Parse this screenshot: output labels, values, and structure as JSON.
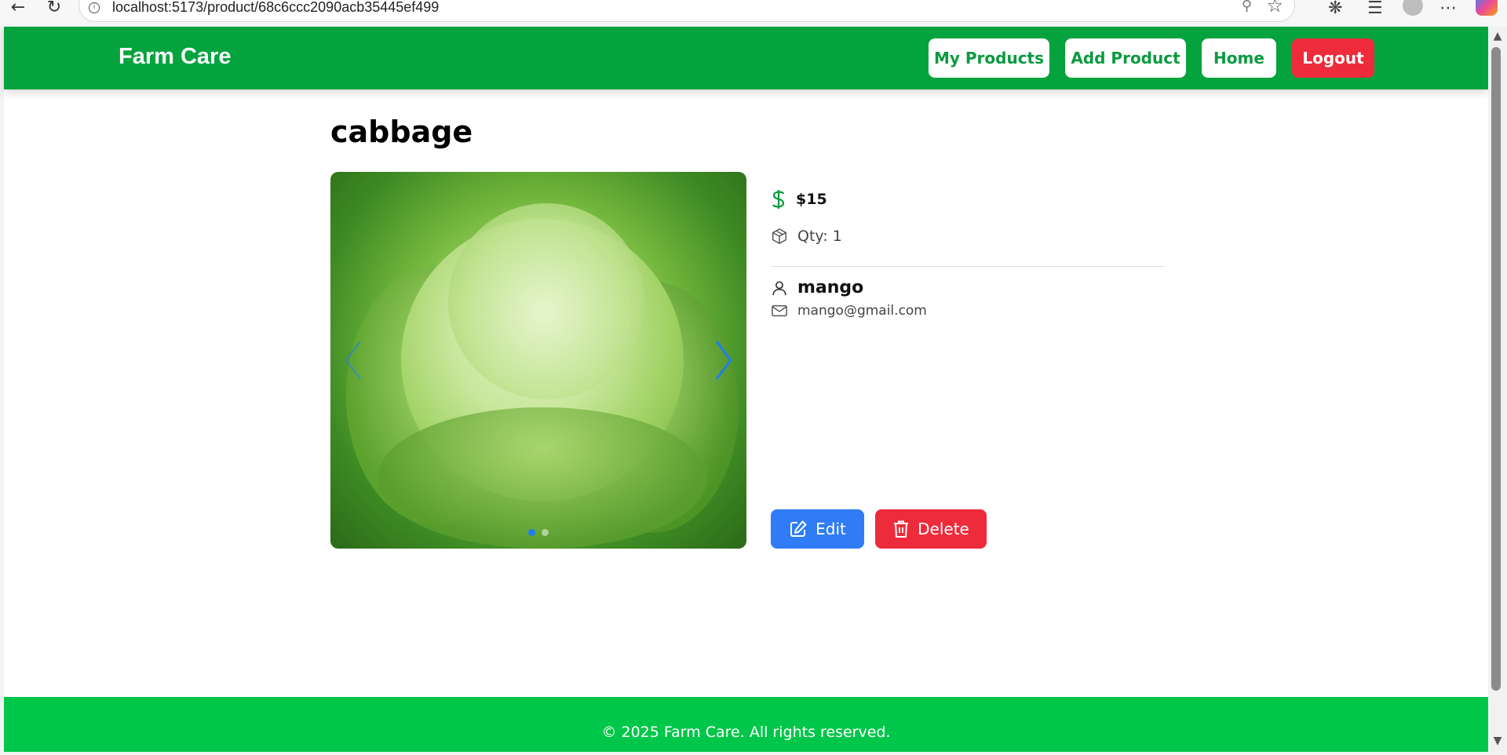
{
  "browser": {
    "url": "localhost:5173/product/68c6ccc2090acb35445ef499"
  },
  "header": {
    "brand": "Farm Care",
    "nav": {
      "my_products": "My Products",
      "add_product": "Add Product",
      "home": "Home",
      "logout": "Logout"
    },
    "colors": {
      "header_bg": "#04a33e",
      "logout_bg": "#ee2b3b"
    }
  },
  "product": {
    "name": "cabbage",
    "price": "$15",
    "qty": "Qty: 1",
    "image_alt": "cabbage",
    "carousel": {
      "total_slides": 2,
      "active_slide": 1
    }
  },
  "seller": {
    "name": "mango",
    "email": "mango@gmail.com"
  },
  "actions": {
    "edit": "Edit",
    "delete": "Delete"
  },
  "footer": {
    "text": "© 2025 Farm Care. All rights reserved."
  },
  "icons": [
    "back-icon",
    "reload-icon",
    "info-icon",
    "key-icon",
    "star-icon",
    "extensions-icon",
    "favorites-icon",
    "profile-icon",
    "more-icon",
    "copilot-icon",
    "dollar-icon",
    "box-icon",
    "user-icon",
    "mail-icon",
    "edit-icon",
    "trash-icon",
    "chevron-left-icon",
    "chevron-right-icon"
  ]
}
